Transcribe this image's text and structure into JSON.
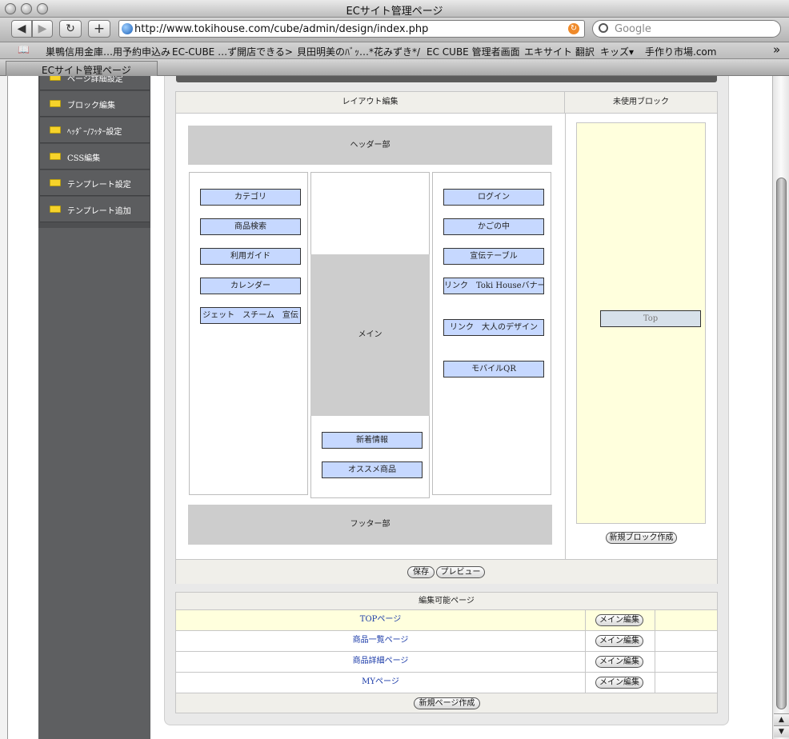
{
  "browser": {
    "window_title": "ECサイト管理ページ",
    "url": "http://www.tokihouse.com/cube/admin/design/index.php",
    "search_placeholder": "Google",
    "back_icon": "◀",
    "forward_icon": "▶",
    "reload_icon": "↻",
    "add_icon": "+",
    "book_icon": "📖",
    "overflow_icon": "»",
    "bookmarks": [
      "巣鴨信用金庫…用予約申込み",
      "EC-CUBE …ず開店できる>",
      "貝田明美のﾊﾞｯ…*花みずき*/",
      "EC CUBE 管理者画面",
      "エキサイト 翻訳",
      "キッズ▾",
      "手作り市場.com"
    ],
    "tab_label": "ECサイト管理ページ"
  },
  "sidebar": {
    "items": [
      {
        "label": "ページ詳細設定"
      },
      {
        "label": "ブロック編集"
      },
      {
        "label": "ﾍｯﾀﾞｰ/ﾌｯﾀｰ設定"
      },
      {
        "label": "CSS編集"
      },
      {
        "label": "テンプレート設定"
      },
      {
        "label": "テンプレート追加"
      }
    ]
  },
  "layout_editor": {
    "header_layout": "レイアウト編集",
    "header_unused": "未使用ブロック",
    "header_zone": "ヘッダー部",
    "footer_zone": "フッター部",
    "main_zone": "メイン",
    "left_blocks": [
      "カテゴリ",
      "商品検索",
      "利用ガイド",
      "カレンダー",
      "ジェット　スチーム　宣伝"
    ],
    "center_blocks": [
      "新着情報",
      "オススメ商品"
    ],
    "right_blocks": [
      "ログイン",
      "かごの中",
      "宣伝テーブル",
      "リンク　Toki Houseバナー",
      "リンク　大人のデザイン",
      "モバイルQR"
    ],
    "unused_blocks": [
      "Top"
    ],
    "new_block_button": "新規ブロック作成",
    "save_button": "保存",
    "preview_button": "プレビュー"
  },
  "pages": {
    "header": "編集可能ページ",
    "rows": [
      {
        "name": "TOPページ",
        "button": "メイン編集"
      },
      {
        "name": "商品一覧ページ",
        "button": "メイン編集"
      },
      {
        "name": "商品詳細ページ",
        "button": "メイン編集"
      },
      {
        "name": "MYページ",
        "button": "メイン編集"
      }
    ],
    "new_page_button": "新規ページ作成"
  },
  "colors": {
    "block_fill": "#c6d8ff",
    "unused_area": "#ffffdd",
    "highlight_row": "#ffffdd",
    "sidebar": "#5e5f61"
  }
}
